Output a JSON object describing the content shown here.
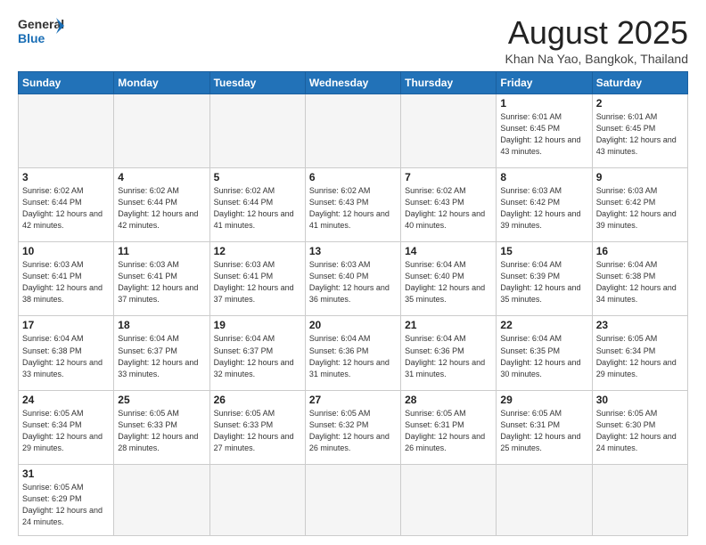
{
  "logo": {
    "line1": "General",
    "line2": "Blue"
  },
  "title": "August 2025",
  "subtitle": "Khan Na Yao, Bangkok, Thailand",
  "weekdays": [
    "Sunday",
    "Monday",
    "Tuesday",
    "Wednesday",
    "Thursday",
    "Friday",
    "Saturday"
  ],
  "weeks": [
    [
      {
        "day": "",
        "info": ""
      },
      {
        "day": "",
        "info": ""
      },
      {
        "day": "",
        "info": ""
      },
      {
        "day": "",
        "info": ""
      },
      {
        "day": "",
        "info": ""
      },
      {
        "day": "1",
        "info": "Sunrise: 6:01 AM\nSunset: 6:45 PM\nDaylight: 12 hours\nand 43 minutes."
      },
      {
        "day": "2",
        "info": "Sunrise: 6:01 AM\nSunset: 6:45 PM\nDaylight: 12 hours\nand 43 minutes."
      }
    ],
    [
      {
        "day": "3",
        "info": "Sunrise: 6:02 AM\nSunset: 6:44 PM\nDaylight: 12 hours\nand 42 minutes."
      },
      {
        "day": "4",
        "info": "Sunrise: 6:02 AM\nSunset: 6:44 PM\nDaylight: 12 hours\nand 42 minutes."
      },
      {
        "day": "5",
        "info": "Sunrise: 6:02 AM\nSunset: 6:44 PM\nDaylight: 12 hours\nand 41 minutes."
      },
      {
        "day": "6",
        "info": "Sunrise: 6:02 AM\nSunset: 6:43 PM\nDaylight: 12 hours\nand 41 minutes."
      },
      {
        "day": "7",
        "info": "Sunrise: 6:02 AM\nSunset: 6:43 PM\nDaylight: 12 hours\nand 40 minutes."
      },
      {
        "day": "8",
        "info": "Sunrise: 6:03 AM\nSunset: 6:42 PM\nDaylight: 12 hours\nand 39 minutes."
      },
      {
        "day": "9",
        "info": "Sunrise: 6:03 AM\nSunset: 6:42 PM\nDaylight: 12 hours\nand 39 minutes."
      }
    ],
    [
      {
        "day": "10",
        "info": "Sunrise: 6:03 AM\nSunset: 6:41 PM\nDaylight: 12 hours\nand 38 minutes."
      },
      {
        "day": "11",
        "info": "Sunrise: 6:03 AM\nSunset: 6:41 PM\nDaylight: 12 hours\nand 37 minutes."
      },
      {
        "day": "12",
        "info": "Sunrise: 6:03 AM\nSunset: 6:41 PM\nDaylight: 12 hours\nand 37 minutes."
      },
      {
        "day": "13",
        "info": "Sunrise: 6:03 AM\nSunset: 6:40 PM\nDaylight: 12 hours\nand 36 minutes."
      },
      {
        "day": "14",
        "info": "Sunrise: 6:04 AM\nSunset: 6:40 PM\nDaylight: 12 hours\nand 35 minutes."
      },
      {
        "day": "15",
        "info": "Sunrise: 6:04 AM\nSunset: 6:39 PM\nDaylight: 12 hours\nand 35 minutes."
      },
      {
        "day": "16",
        "info": "Sunrise: 6:04 AM\nSunset: 6:38 PM\nDaylight: 12 hours\nand 34 minutes."
      }
    ],
    [
      {
        "day": "17",
        "info": "Sunrise: 6:04 AM\nSunset: 6:38 PM\nDaylight: 12 hours\nand 33 minutes."
      },
      {
        "day": "18",
        "info": "Sunrise: 6:04 AM\nSunset: 6:37 PM\nDaylight: 12 hours\nand 33 minutes."
      },
      {
        "day": "19",
        "info": "Sunrise: 6:04 AM\nSunset: 6:37 PM\nDaylight: 12 hours\nand 32 minutes."
      },
      {
        "day": "20",
        "info": "Sunrise: 6:04 AM\nSunset: 6:36 PM\nDaylight: 12 hours\nand 31 minutes."
      },
      {
        "day": "21",
        "info": "Sunrise: 6:04 AM\nSunset: 6:36 PM\nDaylight: 12 hours\nand 31 minutes."
      },
      {
        "day": "22",
        "info": "Sunrise: 6:04 AM\nSunset: 6:35 PM\nDaylight: 12 hours\nand 30 minutes."
      },
      {
        "day": "23",
        "info": "Sunrise: 6:05 AM\nSunset: 6:34 PM\nDaylight: 12 hours\nand 29 minutes."
      }
    ],
    [
      {
        "day": "24",
        "info": "Sunrise: 6:05 AM\nSunset: 6:34 PM\nDaylight: 12 hours\nand 29 minutes."
      },
      {
        "day": "25",
        "info": "Sunrise: 6:05 AM\nSunset: 6:33 PM\nDaylight: 12 hours\nand 28 minutes."
      },
      {
        "day": "26",
        "info": "Sunrise: 6:05 AM\nSunset: 6:33 PM\nDaylight: 12 hours\nand 27 minutes."
      },
      {
        "day": "27",
        "info": "Sunrise: 6:05 AM\nSunset: 6:32 PM\nDaylight: 12 hours\nand 26 minutes."
      },
      {
        "day": "28",
        "info": "Sunrise: 6:05 AM\nSunset: 6:31 PM\nDaylight: 12 hours\nand 26 minutes."
      },
      {
        "day": "29",
        "info": "Sunrise: 6:05 AM\nSunset: 6:31 PM\nDaylight: 12 hours\nand 25 minutes."
      },
      {
        "day": "30",
        "info": "Sunrise: 6:05 AM\nSunset: 6:30 PM\nDaylight: 12 hours\nand 24 minutes."
      }
    ],
    [
      {
        "day": "31",
        "info": "Sunrise: 6:05 AM\nSunset: 6:29 PM\nDaylight: 12 hours\nand 24 minutes."
      },
      {
        "day": "",
        "info": ""
      },
      {
        "day": "",
        "info": ""
      },
      {
        "day": "",
        "info": ""
      },
      {
        "day": "",
        "info": ""
      },
      {
        "day": "",
        "info": ""
      },
      {
        "day": "",
        "info": ""
      }
    ]
  ]
}
